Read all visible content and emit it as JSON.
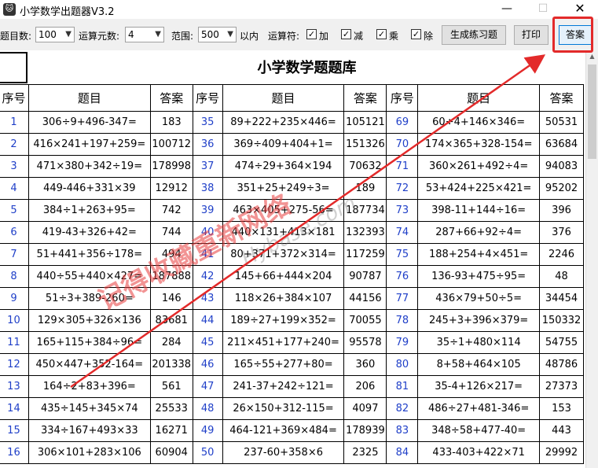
{
  "window": {
    "title": "小学数学出题器V3.2",
    "icon": "cat-icon",
    "minimize": "—",
    "maximize": "☐",
    "close": "✕"
  },
  "toolbar": {
    "count_label": "题目数:",
    "count_value": "100",
    "operands_label": "运算元数:",
    "operands_value": "4",
    "range_label": "范围:",
    "range_value": "500",
    "range_suffix": "以内",
    "ops_label": "运算符:",
    "ops": [
      {
        "label": "加",
        "checked": true
      },
      {
        "label": "减",
        "checked": true
      },
      {
        "label": "乘",
        "checked": true
      },
      {
        "label": "除",
        "checked": true
      }
    ],
    "generate_label": "生成练习题",
    "print_label": "打印",
    "answer_label": "答案"
  },
  "sheet": {
    "title": "小学数学题题库",
    "headers": [
      "序号",
      "题目",
      "答案",
      "序号",
      "题目",
      "答案",
      "序号",
      "题目",
      "答案"
    ],
    "rows": [
      [
        "1",
        "306÷9+496-347=",
        "183",
        "35",
        "89+222+235×446=",
        "105121",
        "69",
        "60÷4+146×346=",
        "50531"
      ],
      [
        "2",
        "416×241+197+259=",
        "100712",
        "36",
        "369÷409+404+1=",
        "151326",
        "70",
        "174×365+328-154=",
        "63684"
      ],
      [
        "3",
        "471×380+342÷19=",
        "178998",
        "37",
        "474÷29+364×194",
        "70632",
        "71",
        "360×261+492÷4=",
        "94083"
      ],
      [
        "4",
        "449-446+331×39",
        "12912",
        "38",
        "351+25+249÷3=",
        "189",
        "72",
        "53+424+225×421=",
        "95202"
      ],
      [
        "5",
        "384÷1+263+95=",
        "742",
        "39",
        "463×405+275-56=",
        "187734",
        "73",
        "398-11+144÷16=",
        "396"
      ],
      [
        "6",
        "419-43+326+42=",
        "744",
        "40",
        "440×131+413×181",
        "132393",
        "74",
        "287+66+92÷4=",
        "376"
      ],
      [
        "7",
        "51+441+356÷178=",
        "494",
        "41",
        "80+371+372×314=",
        "117259",
        "75",
        "188+254+4×451=",
        "2246"
      ],
      [
        "8",
        "440÷55+440×427=",
        "187888",
        "42",
        "145+66+444×204",
        "90787",
        "76",
        "136-93+475÷95=",
        "48"
      ],
      [
        "9",
        "51÷3+389-260=",
        "146",
        "43",
        "118×26+384×107",
        "44156",
        "77",
        "436×79+50÷5=",
        "34454"
      ],
      [
        "10",
        "129×305+326×136",
        "83681",
        "44",
        "189÷27+199×352=",
        "70055",
        "78",
        "245+3+396×379=",
        "150332"
      ],
      [
        "11",
        "165+115+384÷96=",
        "284",
        "45",
        "211×451+177+240=",
        "95578",
        "79",
        "35÷1+480×114",
        "54755"
      ],
      [
        "12",
        "450×447+352-164=",
        "201338",
        "46",
        "165÷55+277+80=",
        "360",
        "80",
        "8+58+464×105",
        "48786"
      ],
      [
        "13",
        "164÷2+83+396=",
        "561",
        "47",
        "241-37+242÷121=",
        "206",
        "81",
        "35-4+126×217=",
        "27373"
      ],
      [
        "14",
        "435÷145+345×74",
        "25533",
        "48",
        "26×150+312-115=",
        "4097",
        "82",
        "486÷27+481-346=",
        "153"
      ],
      [
        "15",
        "334÷167+493×33",
        "16271",
        "49",
        "464-121+369×484=",
        "178939",
        "83",
        "348÷58+477-40=",
        "443"
      ],
      [
        "16",
        "306×101+283×106",
        "60904",
        "50",
        "237-60+358×6",
        "2325",
        "84",
        "433-403+422×71",
        "29992"
      ]
    ]
  },
  "watermark": {
    "text": "记得收藏重新网络",
    "site": "Hybase.com"
  },
  "colors": {
    "seq_blue": "#1f3fc8",
    "annotation_red": "#e32a2a",
    "answer_button_border": "#0078d7"
  }
}
